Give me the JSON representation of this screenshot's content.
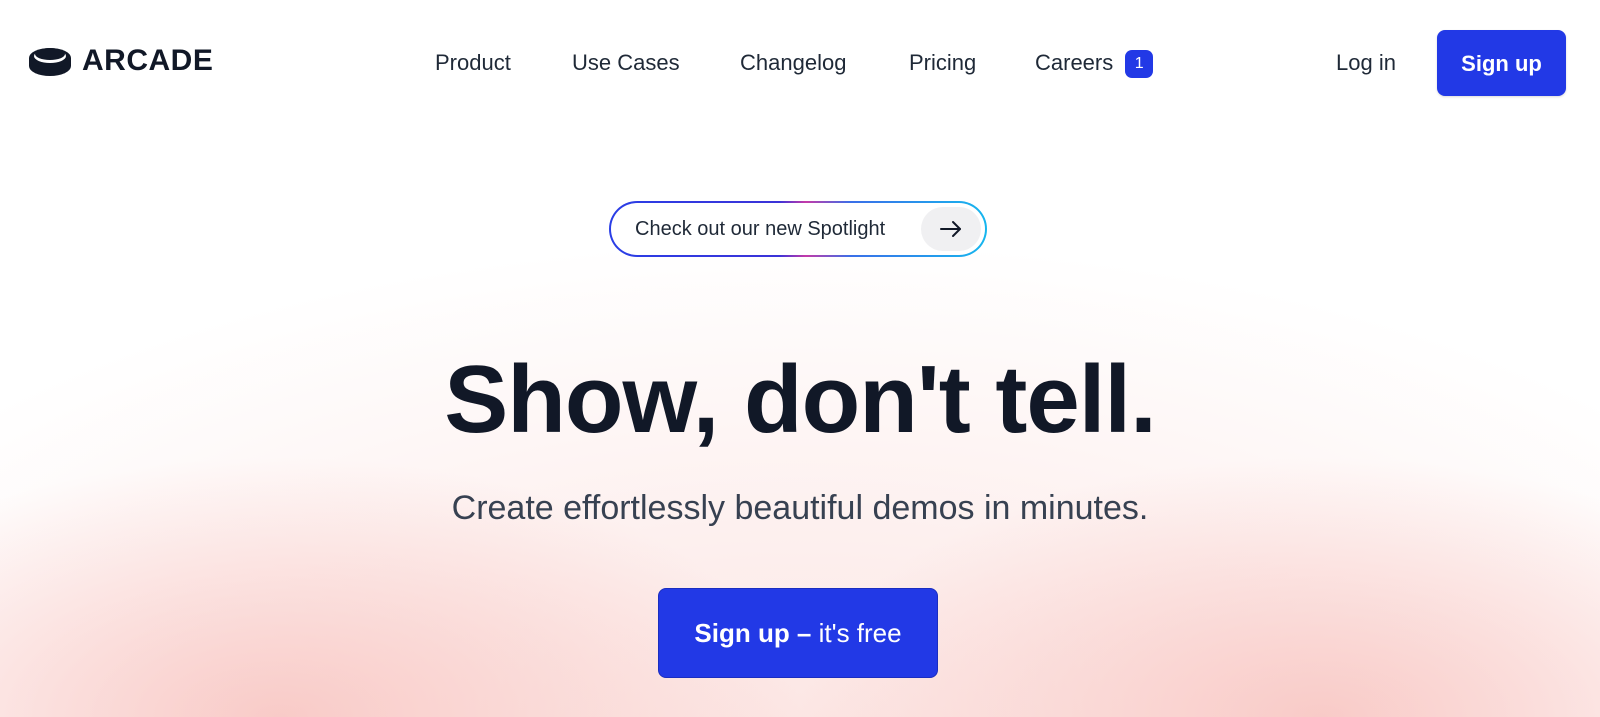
{
  "brand": {
    "name": "ARCADE"
  },
  "nav": {
    "items": [
      {
        "label": "Product"
      },
      {
        "label": "Use Cases"
      },
      {
        "label": "Changelog"
      },
      {
        "label": "Pricing"
      },
      {
        "label": "Careers",
        "badge": "1"
      }
    ]
  },
  "header": {
    "login_label": "Log in",
    "signup_label": "Sign up"
  },
  "hero": {
    "announcement": "Check out our new Spotlight",
    "announcement_icon": "arrow-right-icon",
    "title": "Show, don't tell.",
    "subtitle": "Create effortlessly beautiful demos in minutes.",
    "cta_strong": "Sign up –",
    "cta_rest": " it's free"
  },
  "colors": {
    "accent": "#2239e6",
    "text_dark": "#111827",
    "background_glow": "#f7beba"
  }
}
